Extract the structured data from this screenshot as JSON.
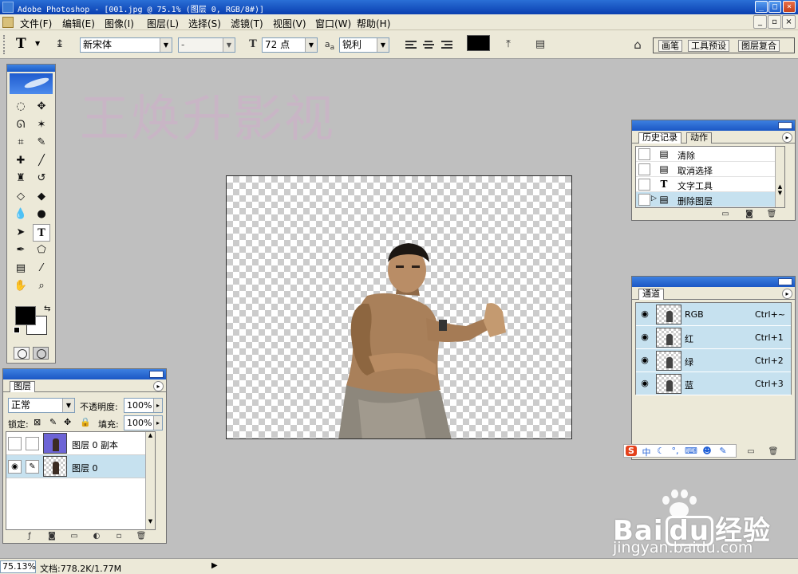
{
  "window": {
    "title": "Adobe Photoshop - [001.jpg @ 75.1% (图层 0, RGB/8#)]",
    "controls": {
      "minimize": "_",
      "maximize": "□",
      "close": "×"
    }
  },
  "menubar": {
    "items": [
      "文件(F)",
      "编辑(E)",
      "图像(I)",
      "图层(L)",
      "选择(S)",
      "滤镜(T)",
      "视图(V)",
      "窗口(W)",
      "帮助(H)"
    ],
    "doc_controls": {
      "minimize": "_",
      "restore": "▫",
      "close": "×"
    }
  },
  "options": {
    "tool": "T",
    "font_family": "新宋体",
    "font_style": "-",
    "font_size": "72 点",
    "aa_label": "a",
    "aa_sub": "a",
    "antialias": "锐利",
    "text_color": "#000000",
    "palette_tabs": [
      "画笔",
      "工具预设",
      "图层复合"
    ]
  },
  "watermark_text": "王焕升影视",
  "toolbox": {
    "tools": [
      {
        "name": "marquee-tool-icon",
        "glyph": "◌"
      },
      {
        "name": "move-tool-icon",
        "glyph": "✥"
      },
      {
        "name": "lasso-tool-icon",
        "glyph": "ᘏ"
      },
      {
        "name": "magic-wand-tool-icon",
        "glyph": "✶"
      },
      {
        "name": "crop-tool-icon",
        "glyph": "⌗"
      },
      {
        "name": "slice-tool-icon",
        "glyph": "✎"
      },
      {
        "name": "healing-brush-tool-icon",
        "glyph": "✚"
      },
      {
        "name": "brush-tool-icon",
        "glyph": "╱"
      },
      {
        "name": "clone-stamp-tool-icon",
        "glyph": "♜"
      },
      {
        "name": "history-brush-tool-icon",
        "glyph": "↺"
      },
      {
        "name": "eraser-tool-icon",
        "glyph": "◇"
      },
      {
        "name": "paint-bucket-tool-icon",
        "glyph": "◆"
      },
      {
        "name": "blur-tool-icon",
        "glyph": "💧"
      },
      {
        "name": "dodge-tool-icon",
        "glyph": "●"
      },
      {
        "name": "path-selection-tool-icon",
        "glyph": "➤"
      },
      {
        "name": "type-tool-icon",
        "glyph": "T"
      },
      {
        "name": "pen-tool-icon",
        "glyph": "✒"
      },
      {
        "name": "shape-tool-icon",
        "glyph": "⬠"
      },
      {
        "name": "notes-tool-icon",
        "glyph": "▤"
      },
      {
        "name": "eyedropper-tool-icon",
        "glyph": "⁄"
      },
      {
        "name": "hand-tool-icon",
        "glyph": "✋"
      },
      {
        "name": "zoom-tool-icon",
        "glyph": "⌕"
      }
    ],
    "foreground_color": "#000000",
    "background_color": "#ffffff"
  },
  "history_panel": {
    "tabs": [
      "历史记录",
      "动作"
    ],
    "items": [
      {
        "label": "清除",
        "icon": "history-step-icon"
      },
      {
        "label": "取消选择",
        "icon": "history-step-icon"
      },
      {
        "label": "文字工具",
        "icon": "type-step-icon"
      },
      {
        "label": "删除图层",
        "icon": "history-step-icon",
        "selected": true
      }
    ]
  },
  "channels_panel": {
    "tabs": [
      "通道"
    ],
    "channels": [
      {
        "name": "RGB",
        "shortcut": "Ctrl+~"
      },
      {
        "name": "红",
        "shortcut": "Ctrl+1"
      },
      {
        "name": "绿",
        "shortcut": "Ctrl+2"
      },
      {
        "name": "蓝",
        "shortcut": "Ctrl+3"
      }
    ]
  },
  "ime_tray": {
    "logo": "S",
    "lang": "中"
  },
  "layers_panel": {
    "tabs": [
      "图层"
    ],
    "blend_mode": "正常",
    "opacity_label": "不透明度:",
    "opacity_value": "100%",
    "lock_label": "锁定:",
    "fill_label": "填充:",
    "fill_value": "100%",
    "layers": [
      {
        "name": "图层 0 副本",
        "visible": false,
        "selected": false
      },
      {
        "name": "图层 0",
        "visible": true,
        "selected": true
      }
    ]
  },
  "statusbar": {
    "zoom": "75.13%",
    "doc_info": "文档:778.2K/1.77M"
  },
  "baidu_watermark": {
    "brand_a": "Bai",
    "brand_b": "du",
    "brand_c": "经验",
    "site": "jingyan.baidu.com"
  }
}
